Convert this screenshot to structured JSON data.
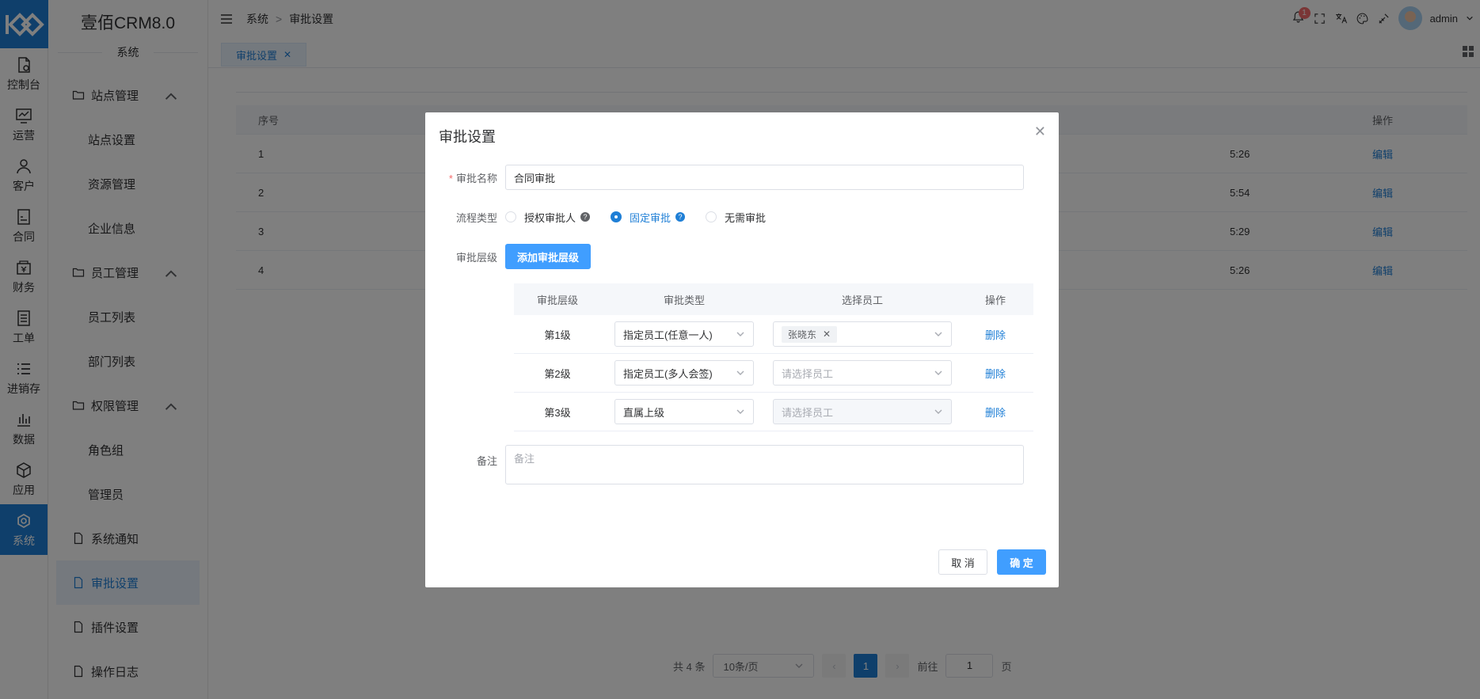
{
  "app": {
    "brand": "壹佰CRM8.0",
    "section": "系统"
  },
  "rail": [
    {
      "label": "控制台",
      "icon": "dashboard-icon"
    },
    {
      "label": "运营",
      "icon": "chart-icon"
    },
    {
      "label": "客户",
      "icon": "customer-icon"
    },
    {
      "label": "合同",
      "icon": "contract-icon"
    },
    {
      "label": "财务",
      "icon": "finance-icon"
    },
    {
      "label": "工单",
      "icon": "ticket-icon"
    },
    {
      "label": "进销存",
      "icon": "list-icon"
    },
    {
      "label": "数据",
      "icon": "data-icon"
    },
    {
      "label": "应用",
      "icon": "app-icon"
    },
    {
      "label": "系统",
      "icon": "system-icon",
      "active": true
    }
  ],
  "sidebar": {
    "groups": [
      {
        "label": "站点管理",
        "items": [
          "站点设置",
          "资源管理",
          "企业信息"
        ]
      },
      {
        "label": "员工管理",
        "items": [
          "员工列表",
          "部门列表"
        ]
      },
      {
        "label": "权限管理",
        "items": [
          "角色组",
          "管理员"
        ]
      }
    ],
    "leaves": [
      "系统通知",
      "审批设置",
      "插件设置",
      "操作日志"
    ]
  },
  "breadcrumb": {
    "root": "系统",
    "current": "审批设置"
  },
  "topbar": {
    "user": "admin",
    "notify_count": "1"
  },
  "tab": {
    "label": "审批设置"
  },
  "bg_table": {
    "headers": {
      "no": "序号",
      "op": "操作"
    },
    "rows": [
      {
        "no": "1",
        "time": "5:26",
        "op": "编辑"
      },
      {
        "no": "2",
        "time": "5:54",
        "op": "编辑"
      },
      {
        "no": "3",
        "time": "5:29",
        "op": "编辑"
      },
      {
        "no": "4",
        "time": "5:26",
        "op": "编辑"
      }
    ]
  },
  "pager": {
    "total": "共 4 条",
    "size": "10条/页",
    "current": "1",
    "goto": "前往",
    "page_value": "1",
    "page_unit": "页"
  },
  "modal": {
    "title": "审批设置",
    "name_label": "审批名称",
    "name_value": "合同审批",
    "flow_label": "流程类型",
    "flow_options": [
      "授权审批人",
      "固定审批",
      "无需审批"
    ],
    "flow_selected": 1,
    "level_label": "审批层级",
    "add_level_btn": "添加审批层级",
    "table_headers": [
      "审批层级",
      "审批类型",
      "选择员工",
      "操作"
    ],
    "levels": [
      {
        "level": "第1级",
        "type": "指定员工(任意一人)",
        "employee_tag": "张晓东",
        "op": "删除"
      },
      {
        "level": "第2级",
        "type": "指定员工(多人会签)",
        "employee_placeholder": "请选择员工",
        "op": "删除"
      },
      {
        "level": "第3级",
        "type": "直属上级",
        "employee_placeholder": "请选择员工",
        "op": "删除"
      }
    ],
    "remark_label": "备注",
    "remark_placeholder": "备注",
    "cancel": "取 消",
    "ok": "确 定"
  }
}
